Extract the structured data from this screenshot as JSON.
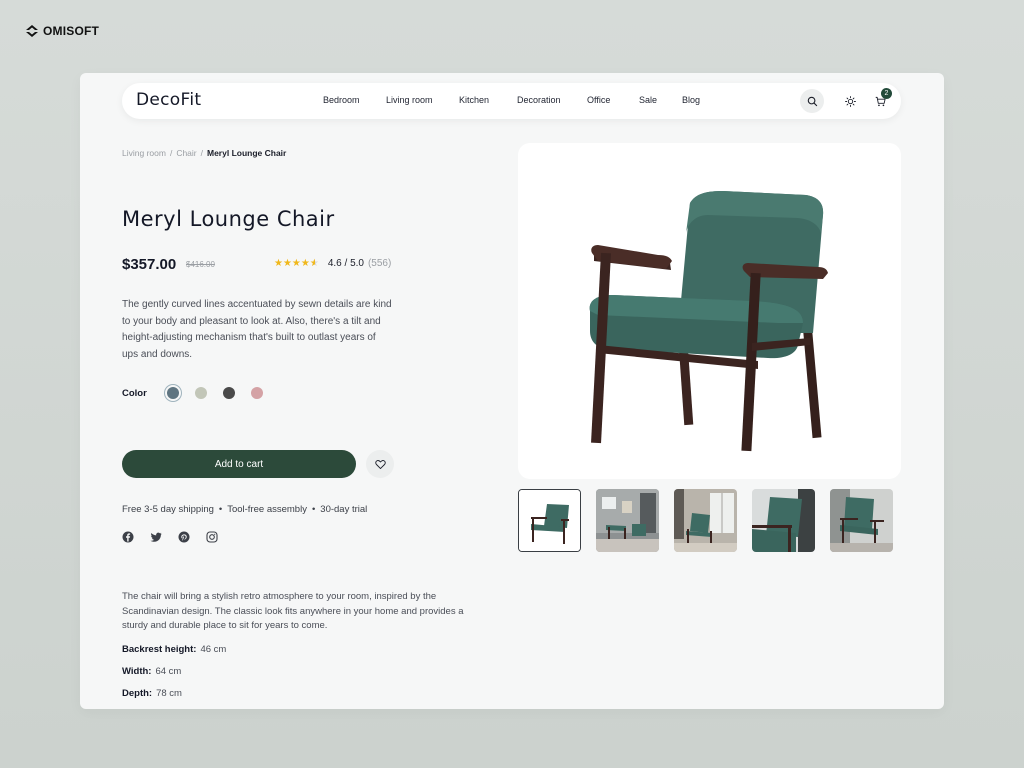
{
  "brand": {
    "name": "OMISOFT",
    "icon": "omisoft-logo-icon"
  },
  "header": {
    "logo": "DecoFit",
    "nav": [
      "Bedroom",
      "Living room",
      "Kitchen",
      "Decoration",
      "Office",
      "Sale",
      "Blog"
    ],
    "icons": {
      "search": "search-icon",
      "theme": "sun-icon",
      "cart": "cart-icon"
    },
    "cart_count": "2"
  },
  "breadcrumb": {
    "items": [
      "Living room",
      "Chair"
    ],
    "current": "Meryl Lounge Chair",
    "separator": "/"
  },
  "product": {
    "title": "Meryl Lounge Chair",
    "price": "$357.00",
    "old_price": "$416.00",
    "rating": {
      "stars": 4.6,
      "value": "4.6 / 5.0",
      "count": "(556)"
    },
    "description": "The gently curved lines accentuated by sewn details are kind to your body and pleasant to look at. Also, there's a tilt and height-adjusting mechanism that's built to outlast years of ups and downs.",
    "color_label": "Color",
    "colors": [
      "#5f7581",
      "#c2c6b8",
      "#4a4a4a",
      "#d4a2a5"
    ],
    "selected_color_index": 0,
    "add_to_cart": "Add to cart",
    "wishlist_icon": "heart-icon",
    "features": [
      "Free 3-5 day shipping",
      "Tool-free assembly",
      "30-day trial"
    ],
    "socials": [
      "facebook-icon",
      "twitter-icon",
      "pinterest-icon",
      "instagram-icon"
    ],
    "long_description": "The chair will bring a stylish retro atmosphere to your room, inspired by the Scandinavian design. The classic look fits anywhere in your home and provides a sturdy and durable place to sit for years to come.",
    "specs": [
      {
        "label": "Backrest height:",
        "value": "46 cm"
      },
      {
        "label": "Width:",
        "value": "64 cm"
      },
      {
        "label": "Depth:",
        "value": "78 cm"
      }
    ],
    "thumbnails": 5,
    "selected_thumbnail": 0
  },
  "colors": {
    "accent": "#2c4a3a",
    "star": "#f0b81c",
    "upholstery": "#3e6b63",
    "wood": "#3b2420"
  }
}
